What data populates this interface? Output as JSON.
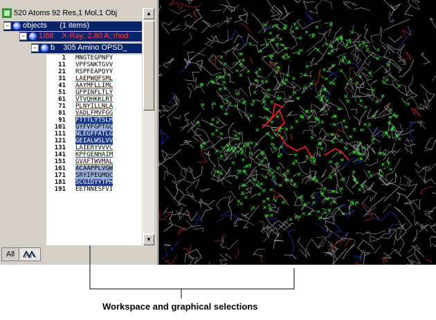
{
  "header": {
    "title": "520 Atoms 92 Res,1 Mol,1 Obj"
  },
  "tree": {
    "objects_label": "objects",
    "objects_count": "(1 items)",
    "object_id": "1I88",
    "object_desc": "X-Ray; 2.80 A; rhod",
    "chain_label": "b",
    "chain_desc": "305 Amino OPSD_"
  },
  "sequence_rows": [
    {
      "num": "1",
      "res": "MNGTEGPNFY"
    },
    {
      "num": "11",
      "res": "VPFSNKTGVV"
    },
    {
      "num": "21",
      "res": "RSPFEAPQYY"
    },
    {
      "num": "31",
      "res": "LAEPWQFSML"
    },
    {
      "num": "41",
      "res": "AAYMFLLIML"
    },
    {
      "num": "51",
      "res": "GFPINFLTLY"
    },
    {
      "num": "61",
      "res": "VTVQHKKLRT"
    },
    {
      "num": "71",
      "res": "PLNYILLNLA"
    },
    {
      "num": "81",
      "res": "VADLFMVFGG"
    },
    {
      "num": "91",
      "res": "FTTTLYTSLH"
    },
    {
      "num": "101",
      "res": "GYFVFGPTGC"
    },
    {
      "num": "111",
      "res": "NLEGFFATLG"
    },
    {
      "num": "121",
      "res": "GEIALWSLVV"
    },
    {
      "num": "131",
      "res": "LAIERYVVVC"
    },
    {
      "num": "141",
      "res": "KPFGENHAIM"
    },
    {
      "num": "151",
      "res": "GVAFTWVMAL"
    },
    {
      "num": "161",
      "res": "ACAAPPLVGW"
    },
    {
      "num": "171",
      "res": "SRYIPEGMQC"
    },
    {
      "num": "181",
      "res": "SCGIDYYTPH"
    },
    {
      "num": "191",
      "res": "EETNNESFVI"
    }
  ],
  "tabs": {
    "all_label": "All"
  },
  "caption": "Workspace and graphical selections",
  "colors": {
    "selection": "#0a246a",
    "atoms": "#33ff33",
    "highlight": "#ff2020"
  }
}
